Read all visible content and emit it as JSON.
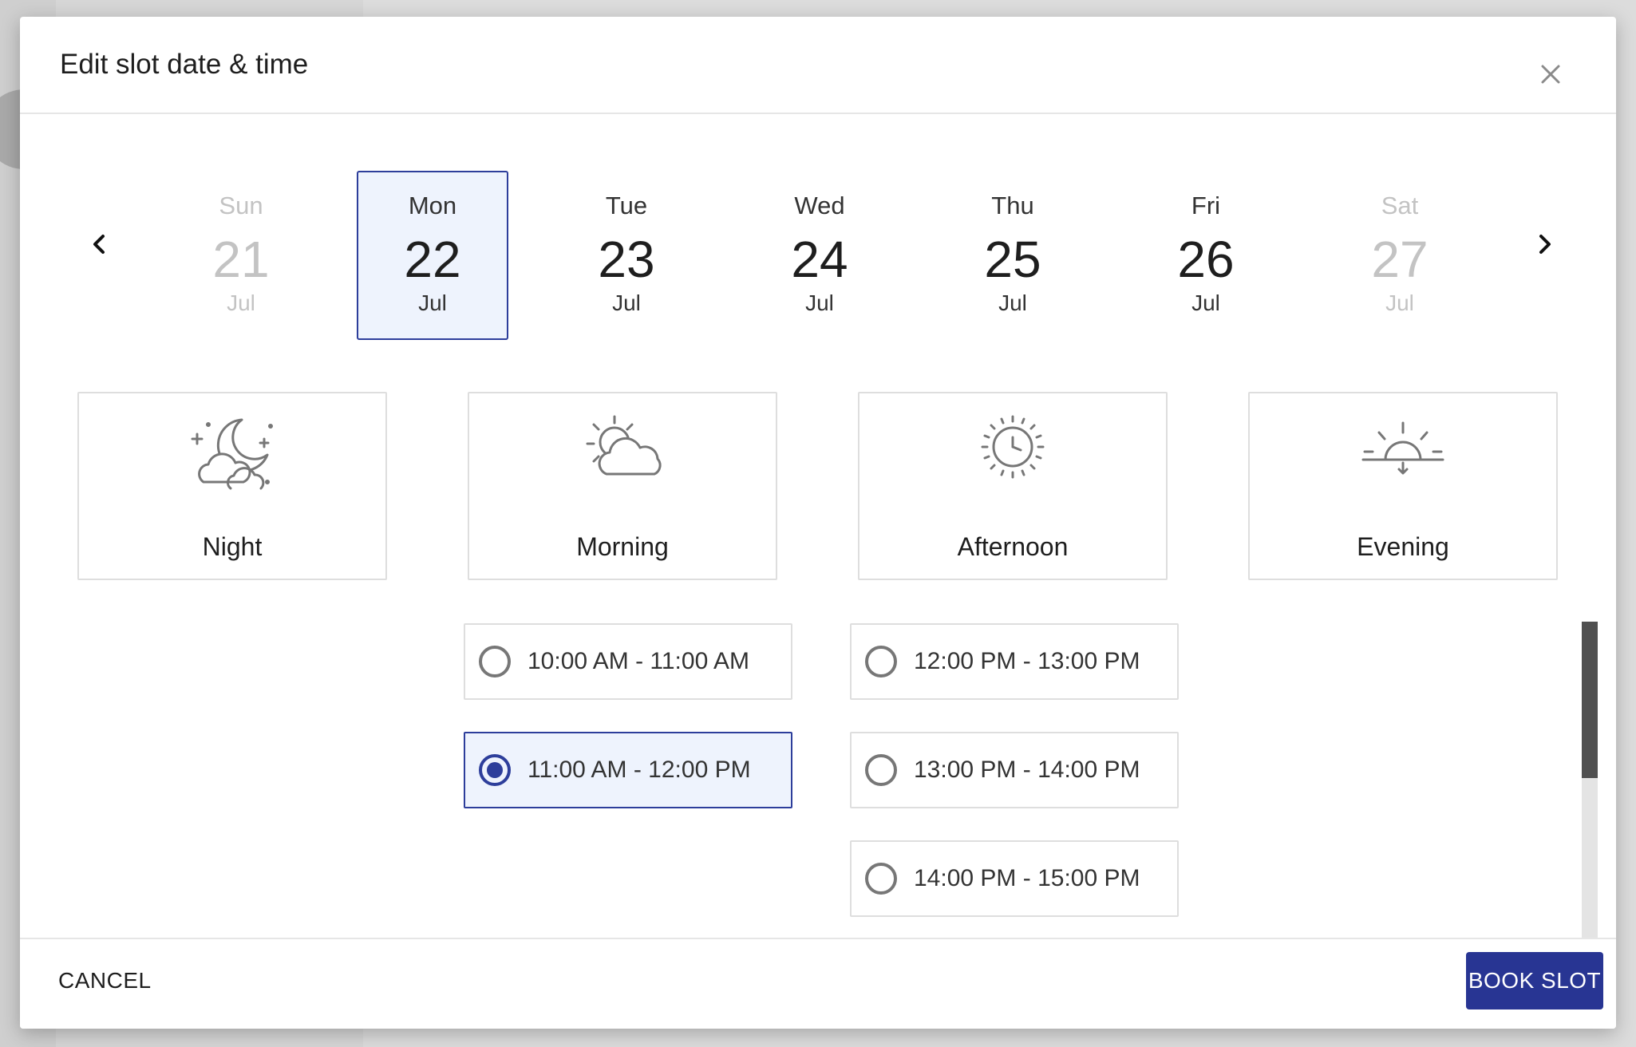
{
  "dialog": {
    "title": "Edit slot date & time",
    "close_icon": "close-icon"
  },
  "date_nav": {
    "prev_icon": "chevron-left-icon",
    "next_icon": "chevron-right-icon"
  },
  "days": [
    {
      "dow": "Sun",
      "num": "21",
      "month": "Jul",
      "state": "disabled"
    },
    {
      "dow": "Mon",
      "num": "22",
      "month": "Jul",
      "state": "selected"
    },
    {
      "dow": "Tue",
      "num": "23",
      "month": "Jul",
      "state": "normal"
    },
    {
      "dow": "Wed",
      "num": "24",
      "month": "Jul",
      "state": "normal"
    },
    {
      "dow": "Thu",
      "num": "25",
      "month": "Jul",
      "state": "normal"
    },
    {
      "dow": "Fri",
      "num": "26",
      "month": "Jul",
      "state": "normal"
    },
    {
      "dow": "Sat",
      "num": "27",
      "month": "Jul",
      "state": "disabled"
    }
  ],
  "periods": [
    {
      "label": "Night",
      "icon": "moon-cloud-icon"
    },
    {
      "label": "Morning",
      "icon": "sun-cloud-icon"
    },
    {
      "label": "Afternoon",
      "icon": "sun-icon"
    },
    {
      "label": "Evening",
      "icon": "sunset-icon"
    }
  ],
  "slots": {
    "morning": [
      {
        "label": "10:00 AM - 11:00 AM",
        "selected": false
      },
      {
        "label": "11:00 AM - 12:00 PM",
        "selected": true
      }
    ],
    "afternoon": [
      {
        "label": "12:00 PM - 13:00 PM",
        "selected": false
      },
      {
        "label": "13:00 PM - 14:00 PM",
        "selected": false
      },
      {
        "label": "14:00 PM - 15:00 PM",
        "selected": false
      }
    ]
  },
  "footer": {
    "cancel_label": "CANCEL",
    "book_label": "BOOK SLOT"
  },
  "colors": {
    "accent": "#283593",
    "selected_bg": "#eef3fd",
    "disabled_text": "#c3c3c3"
  }
}
